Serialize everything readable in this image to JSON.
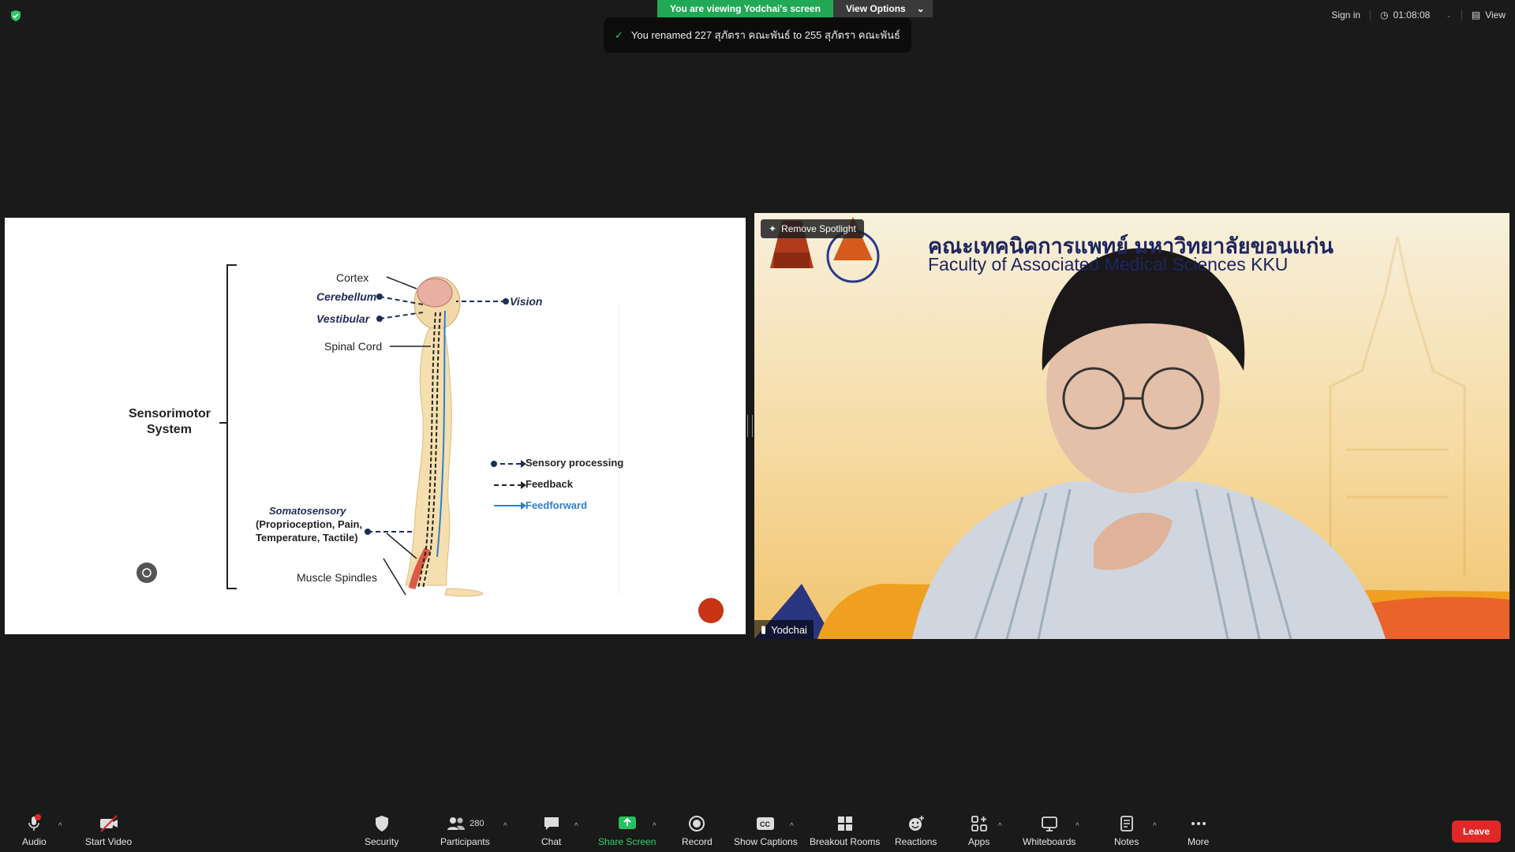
{
  "top": {
    "viewing_banner": "You are viewing Yodchai's screen",
    "view_options": "View Options",
    "toast_message": "You renamed 227 สุภัตรา คณะพันธ์ to 255 สุภัตรา คณะพันธ์",
    "sign_in": "Sign in",
    "timer": "01:08:08",
    "view": "View"
  },
  "slide": {
    "labels": {
      "cortex": "Cortex",
      "cerebellum": "Cerebellum",
      "vestibular": "Vestibular",
      "spinal_cord": "Spinal Cord",
      "vision": "Vision",
      "system_line1": "Sensorimotor",
      "system_line2": "System",
      "somatosensory_title": "Somatosensory",
      "somatosensory_line2": "(Proprioception, Pain,",
      "somatosensory_line3": "Temperature, Tactile)",
      "muscle_spindles": "Muscle Spindles"
    },
    "legend": {
      "sensory": "Sensory processing",
      "feedback": "Feedback",
      "feedforward": "Feedforward"
    }
  },
  "video": {
    "faculty_thai": "คณะเทคนิคการแพทย์ มหาวิทยาลัยขอนแก่น",
    "faculty_english": "Faculty of Associated Medical Sciences KKU",
    "remove_spotlight": "Remove Spotlight",
    "participant_name": "Yodchai"
  },
  "toolbar": {
    "audio": "Audio",
    "start_video": "Start Video",
    "security": "Security",
    "participants": "Participants",
    "participants_count": "280",
    "chat": "Chat",
    "share_screen": "Share Screen",
    "record": "Record",
    "show_captions": "Show Captions",
    "breakout_rooms": "Breakout Rooms",
    "reactions": "Reactions",
    "apps": "Apps",
    "whiteboards": "Whiteboards",
    "notes": "Notes",
    "more": "More",
    "leave": "Leave"
  },
  "colors": {
    "accent_green": "#23a856",
    "leave_red": "#e02828",
    "slide_navy": "#1e2d55",
    "feedforward_blue": "#2e7fd0"
  }
}
